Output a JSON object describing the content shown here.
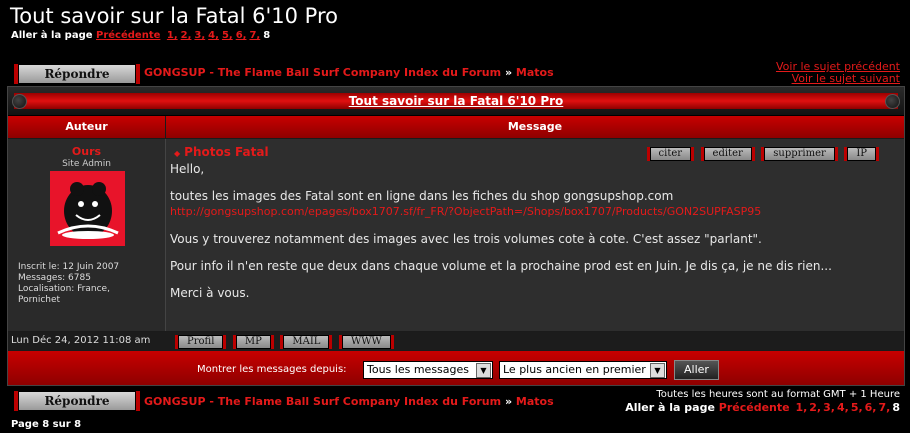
{
  "page_title": "Tout savoir sur la Fatal 6'10 Pro",
  "pager": {
    "label": "Aller à la page",
    "prev": "Précédente",
    "pages": [
      "1,",
      "2,",
      "3,",
      "4,",
      "5,",
      "6,",
      "7,"
    ],
    "current": "8"
  },
  "reply_label": "Répondre",
  "breadcrumb": {
    "forum_index": "GONGSUP - The Flame Ball Surf Company Index du Forum",
    "sep": "»",
    "section": "Matos"
  },
  "topnav": {
    "prev_topic": "Voir le sujet précédent",
    "next_topic": "Voir le sujet suivant"
  },
  "topic_link": "Tout savoir sur la Fatal 6'10 Pro",
  "columns": {
    "author": "Auteur",
    "message": "Message"
  },
  "post": {
    "username": "Ours",
    "rank": "Site Admin",
    "joined": "Inscrit le: 12 Juin 2007",
    "messages": "Messages: 6785",
    "location_1": "Localisation: France,",
    "location_2": "Pornichet",
    "title": "Photos Fatal",
    "actions": [
      "citer",
      "editer",
      "supprimer",
      "IP"
    ],
    "body": {
      "p1": "Hello,",
      "p2": "toutes les images des Fatal sont en ligne dans les fiches du shop gongsupshop.com",
      "link": "http://gongsupshop.com/epages/box1707.sf/fr_FR/?ObjectPath=/Shops/box1707/Products/GON2SUPFASP95",
      "p3": "Vous y trouverez notamment des images avec les trois volumes cote à cote. C'est assez \"parlant\".",
      "p4": "Pour info il n'en reste que deux dans chaque volume et la prochaine prod est en Juin. Je dis ça, je ne dis rien...",
      "p5": "Merci à vous."
    },
    "date": "Lun Déc 24, 2012 11:08 am",
    "profile_buttons": [
      "Profil",
      "MP",
      "MAIL",
      "WWW"
    ]
  },
  "filter": {
    "label": "Montrer les messages depuis:",
    "range": "Tous les messages",
    "order": "Le plus ancien en premier",
    "go": "Aller"
  },
  "timezone": "Toutes les heures sont au format GMT + 1 Heure",
  "page_of": "Page 8 sur 8",
  "colors": {
    "accent": "#e41a1a",
    "bar": "#c80000",
    "bg": "#000000"
  }
}
